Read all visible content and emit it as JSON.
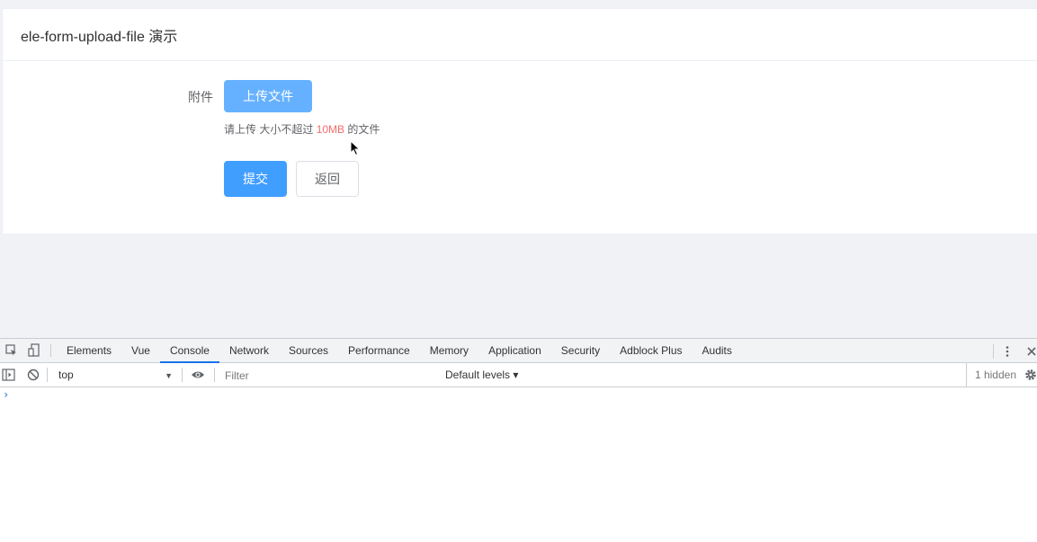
{
  "app": {
    "card_title": "ele-form-upload-file 演示",
    "form": {
      "attachment_label": "附件",
      "upload_button": "上传文件",
      "tip_prefix": "请上传 大小不超过",
      "tip_size": "10MB",
      "tip_suffix": "的文件",
      "submit_button": "提交",
      "back_button": "返回"
    },
    "colors": {
      "primary": "#409eff",
      "primary_light": "#66b1ff",
      "danger": "#f56c6c"
    }
  },
  "devtools": {
    "tabs": [
      {
        "label": "Elements"
      },
      {
        "label": "Vue"
      },
      {
        "label": "Console",
        "active": true
      },
      {
        "label": "Network"
      },
      {
        "label": "Sources"
      },
      {
        "label": "Performance"
      },
      {
        "label": "Memory"
      },
      {
        "label": "Application"
      },
      {
        "label": "Security"
      },
      {
        "label": "Adblock Plus"
      },
      {
        "label": "Audits"
      }
    ],
    "context": "top",
    "filter_placeholder": "Filter",
    "levels": "Default levels ▾",
    "hidden": "1 hidden",
    "prompt": "›"
  }
}
